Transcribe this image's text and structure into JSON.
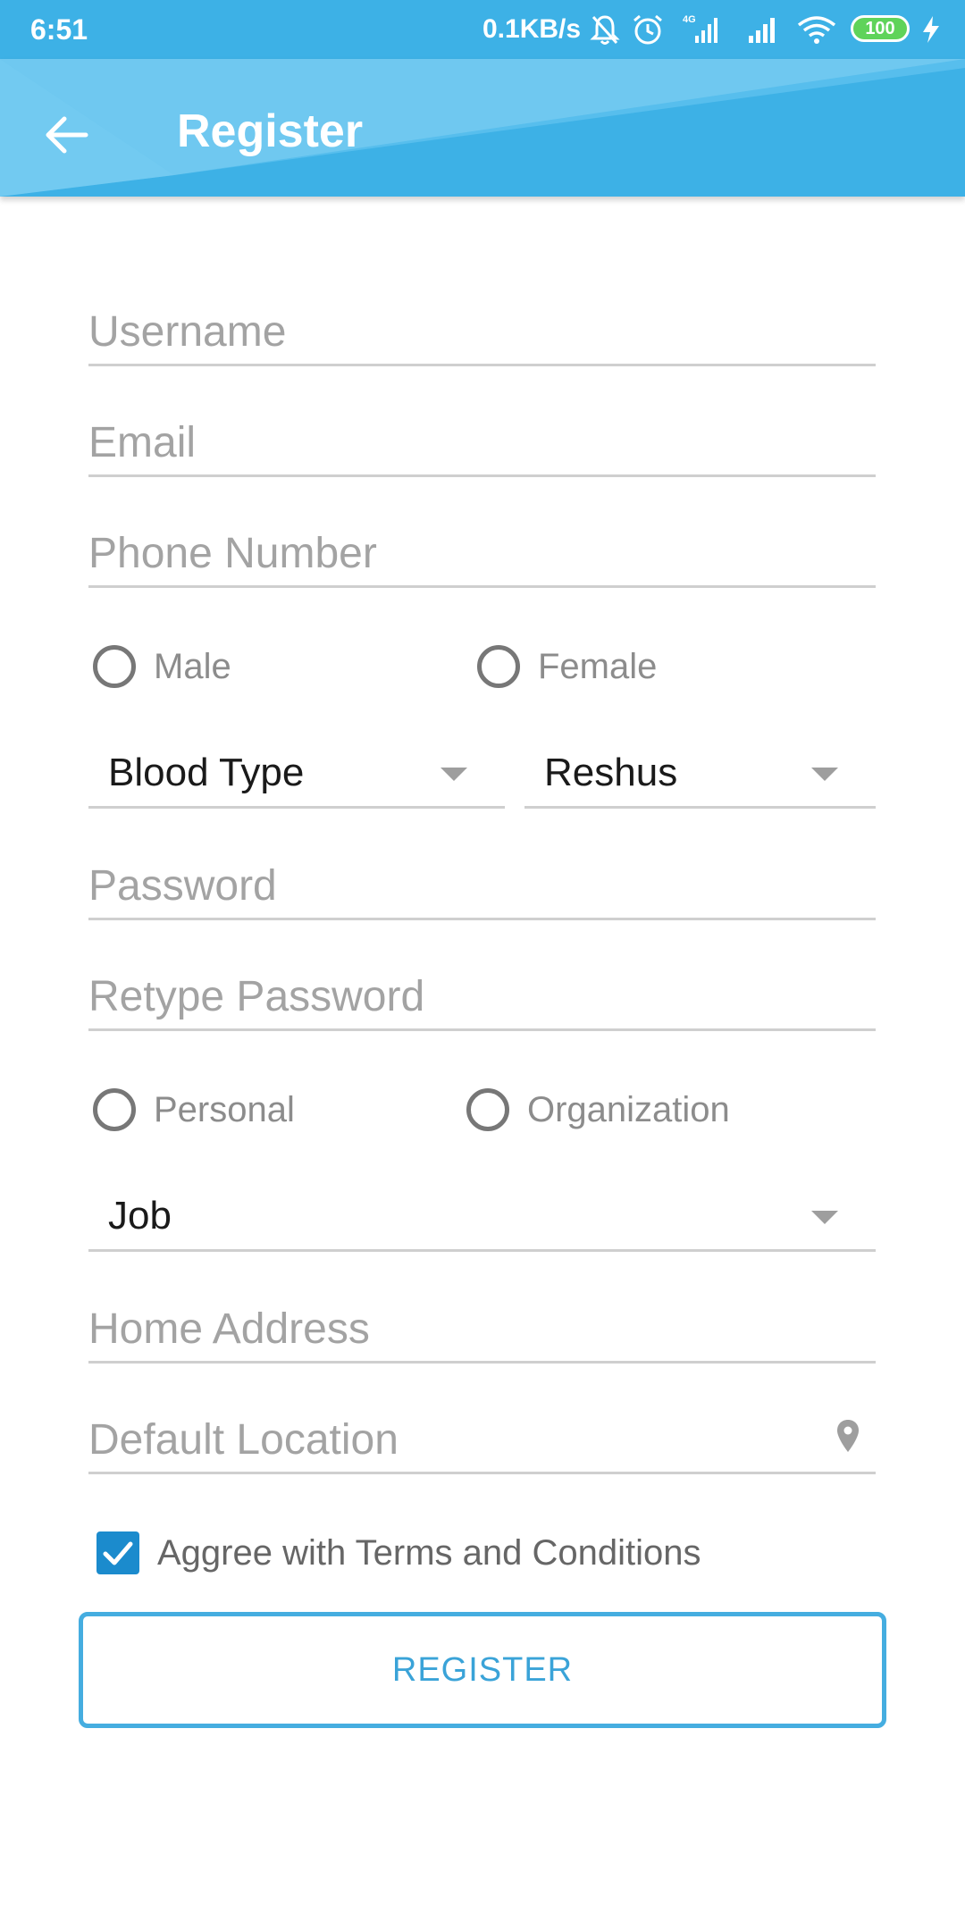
{
  "status_bar": {
    "time": "6:51",
    "network_speed": "0.1KB/s",
    "battery_level": "100",
    "icons": [
      "notification-off-icon",
      "alarm-icon",
      "signal-4g-icon",
      "signal-icon",
      "wifi-icon",
      "battery-icon",
      "charging-icon"
    ]
  },
  "app_bar": {
    "title": "Register",
    "back_icon": "arrow-back-icon",
    "color": "#3db1e6"
  },
  "form": {
    "username": {
      "placeholder": "Username",
      "value": ""
    },
    "email": {
      "placeholder": "Email",
      "value": ""
    },
    "phone": {
      "placeholder": "Phone Number",
      "value": ""
    },
    "gender": {
      "options": [
        {
          "label": "Male",
          "selected": false
        },
        {
          "label": "Female",
          "selected": false
        }
      ]
    },
    "blood_type": {
      "value": "Blood Type"
    },
    "rhesus": {
      "value": "Reshus"
    },
    "password": {
      "placeholder": "Password",
      "value": ""
    },
    "retype_password": {
      "placeholder": "Retype Password",
      "value": ""
    },
    "account_type": {
      "options": [
        {
          "label": "Personal",
          "selected": false
        },
        {
          "label": "Organization",
          "selected": false
        }
      ]
    },
    "job": {
      "value": "Job"
    },
    "home_address": {
      "placeholder": "Home Address",
      "value": ""
    },
    "default_location": {
      "placeholder": "Default Location",
      "value": "",
      "icon": "location-pin-icon"
    },
    "terms": {
      "label": "Aggree with Terms and Conditions",
      "checked": true
    },
    "submit_label": "REGISTER"
  },
  "colors": {
    "accent": "#3db1e6",
    "checkbox": "#1b8bcd",
    "button_text": "#3aa3d8"
  }
}
